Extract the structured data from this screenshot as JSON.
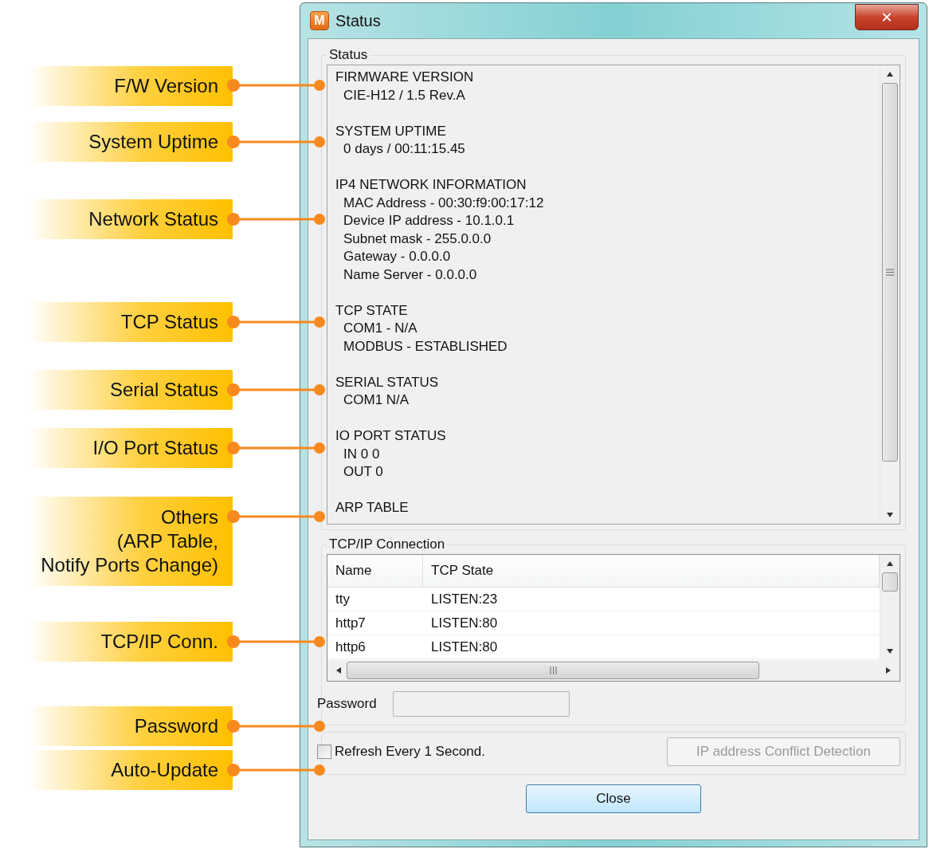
{
  "callouts": [
    {
      "lines": [
        "F/W Version"
      ]
    },
    {
      "lines": [
        "System Uptime"
      ]
    },
    {
      "lines": [
        "Network Status"
      ]
    },
    {
      "lines": [
        "TCP Status"
      ]
    },
    {
      "lines": [
        "Serial Status"
      ]
    },
    {
      "lines": [
        "I/O Port Status"
      ]
    },
    {
      "lines": [
        "Others",
        "(ARP Table,",
        "Notify Ports Change)"
      ]
    },
    {
      "lines": [
        "TCP/IP Conn."
      ]
    },
    {
      "lines": [
        "Password"
      ]
    },
    {
      "lines": [
        "Auto-Update"
      ]
    }
  ],
  "window": {
    "title": "Status",
    "app_icon_letter": "M",
    "close_glyph": "✕"
  },
  "status_group": {
    "title": "Status",
    "sections": [
      {
        "heading": "FIRMWARE VERSION",
        "lines": [
          "CIE-H12 / 1.5 Rev.A"
        ]
      },
      {
        "heading": "SYSTEM UPTIME",
        "lines": [
          "0 days / 00:11:15.45"
        ]
      },
      {
        "heading": "IP4 NETWORK INFORMATION",
        "lines": [
          "MAC Address - 00:30:f9:00:17:12",
          "Device IP address - 10.1.0.1",
          "Subnet mask - 255.0.0.0",
          "Gateway - 0.0.0.0",
          "Name Server - 0.0.0.0"
        ]
      },
      {
        "heading": "TCP STATE",
        "lines": [
          "COM1 - N/A",
          "MODBUS - ESTABLISHED"
        ]
      },
      {
        "heading": "SERIAL STATUS",
        "lines": [
          "COM1  N/A"
        ]
      },
      {
        "heading": "IO PORT STATUS",
        "lines": [
          "IN  0 0",
          "OUT  0"
        ]
      },
      {
        "heading": "ARP TABLE"
      }
    ]
  },
  "tcpip_group": {
    "title": "TCP/IP Connection",
    "columns": [
      "Name",
      "TCP State"
    ],
    "rows": [
      [
        "tty",
        "LISTEN:23"
      ],
      [
        "http7",
        "LISTEN:80"
      ],
      [
        "http6",
        "LISTEN:80"
      ]
    ],
    "password": {
      "label": "Password"
    }
  },
  "auto_update": {
    "checkbox": {
      "label": "Refresh Every 1 Second.",
      "checked": false
    },
    "conflict_button": {
      "label": "IP address Conflict Detection",
      "disabled": true
    }
  },
  "close_button": {
    "label": "Close"
  }
}
